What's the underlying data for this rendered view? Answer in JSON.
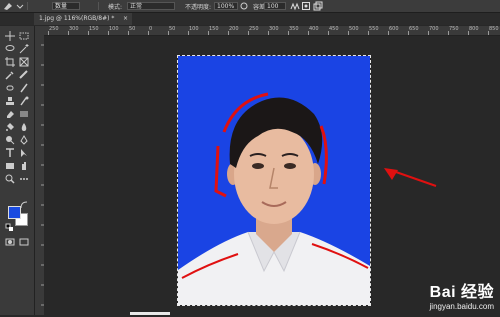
{
  "options_bar": {
    "preset_value": "数量",
    "mode_label": "模式:",
    "mode_value": "正常",
    "opacity_label": "不透明度:",
    "opacity_value": "100%",
    "flow_label": "容差:",
    "flow_value": "100"
  },
  "document_tab": {
    "title": "1.jpg @ 116%(RGB/8#) *",
    "close_symbol": "×"
  },
  "rulers": {
    "top_ticks": [
      "250",
      "300",
      "150",
      "100",
      "50",
      "0",
      "50",
      "100",
      "150",
      "200",
      "250",
      "300",
      "350",
      "400",
      "450",
      "500",
      "550",
      "600",
      "650",
      "700",
      "750",
      "800",
      "850"
    ]
  },
  "colors": {
    "foreground": "#1a4be0",
    "background": "#ffffff",
    "canvas_bg": "#1a44e4",
    "annotation": "#e01010"
  },
  "toolbar": {
    "icons": [
      "move-icon",
      "marquee-icon",
      "lasso-icon",
      "magic-wand-icon",
      "crop-icon",
      "frame-icon",
      "eyedropper-icon",
      "spot-heal-icon",
      "brush-icon",
      "stamp-icon",
      "history-brush-icon",
      "eraser-icon",
      "paint-bucket-icon",
      "blur-icon",
      "dodge-icon",
      "pen-icon",
      "type-icon",
      "path-select-icon",
      "rectangle-icon",
      "hand-icon",
      "zoom-icon",
      "edit-toolbar-icon"
    ]
  },
  "watermark": {
    "main": "Bai 经验",
    "sub": "jingyan.baidu.com"
  }
}
